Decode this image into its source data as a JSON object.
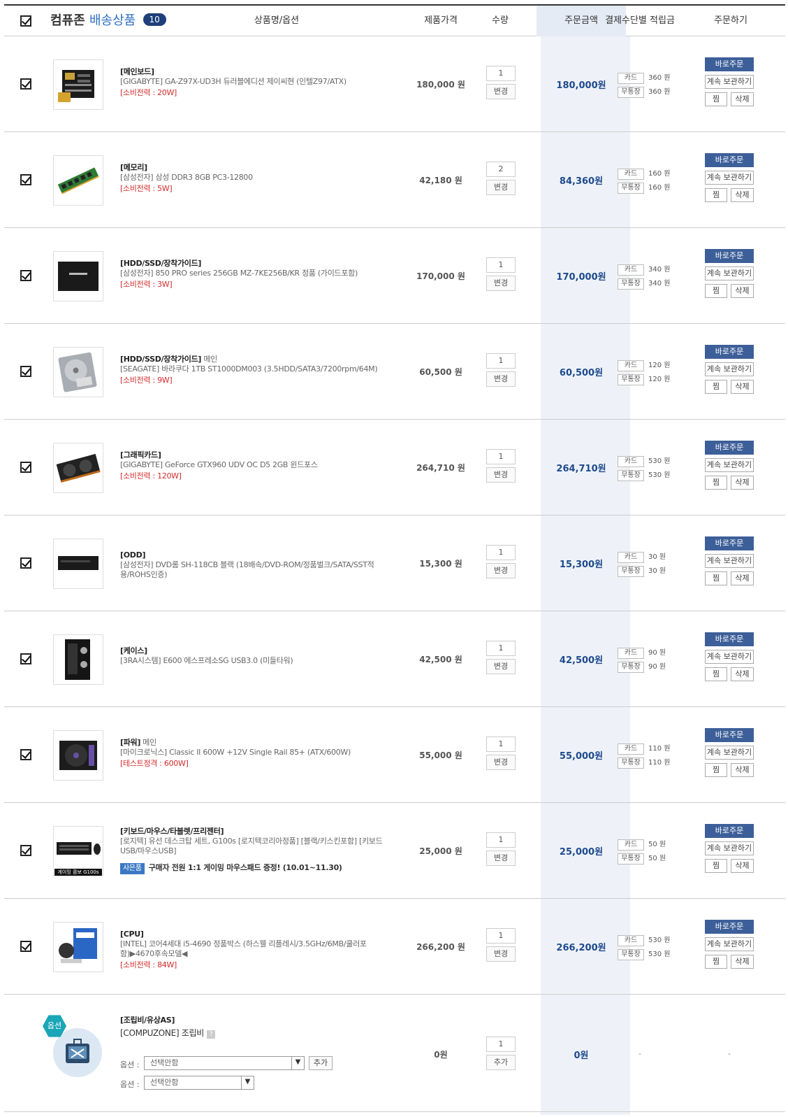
{
  "header": {
    "title_a": "컴퓨존",
    "title_b": "배송상품",
    "count": "10",
    "col_name": "상품명/옵션",
    "col_price": "제품가격",
    "col_qty": "수량",
    "col_amount": "주문금액",
    "col_points": "결제수단별 적립금",
    "col_order": "주문하기"
  },
  "labels": {
    "change": "변경",
    "add": "추가",
    "card": "카드",
    "bankbook": "무통장",
    "buy_now": "바로주문",
    "keep": "계속 보관하기",
    "wish": "찜",
    "delete": "삭제",
    "option": "옵션",
    "option_label": "옵션 :",
    "select_none": "선택안함",
    "gift_tag": "사은품",
    "dash": "-"
  },
  "items": [
    {
      "cat": "[메인보드]",
      "sub": "",
      "name": "[GIGABYTE] GA-Z97X-UD3H 듀러블에디션 제이씨현 (인텔Z97/ATX)",
      "spec": "[소비전력 : 20W]",
      "price": "180,000 원",
      "qty": "1",
      "amount": "180,000원",
      "card_pt": "360 원",
      "bank_pt": "360 원",
      "thumb": "motherboard"
    },
    {
      "cat": "[메모리]",
      "sub": "",
      "name": "[삼성전자] 삼성 DDR3 8GB PC3-12800",
      "spec": "[소비전력 : 5W]",
      "price": "42,180 원",
      "qty": "2",
      "amount": "84,360원",
      "card_pt": "160 원",
      "bank_pt": "160 원",
      "thumb": "memory"
    },
    {
      "cat": "[HDD/SSD/장착가이드]",
      "sub": "",
      "name": "[삼성전자] 850 PRO series 256GB MZ-7KE256B/KR 정품 (가이드포함)",
      "spec": "[소비전력 : 3W]",
      "price": "170,000 원",
      "qty": "1",
      "amount": "170,000원",
      "card_pt": "340 원",
      "bank_pt": "340 원",
      "thumb": "ssd"
    },
    {
      "cat": "[HDD/SSD/장착가이드]",
      "sub": " 메인",
      "name": "[SEAGATE] 바라쿠다 1TB ST1000DM003 (3.5HDD/SATA3/7200rpm/64M)",
      "spec": "[소비전력 : 9W]",
      "price": "60,500 원",
      "qty": "1",
      "amount": "60,500원",
      "card_pt": "120 원",
      "bank_pt": "120 원",
      "thumb": "hdd"
    },
    {
      "cat": "[그래픽카드]",
      "sub": "",
      "name": "[GIGABYTE] GeForce GTX960 UDV OC D5 2GB 윈드포스",
      "spec": "[소비전력 : 120W]",
      "price": "264,710 원",
      "qty": "1",
      "amount": "264,710원",
      "card_pt": "530 원",
      "bank_pt": "530 원",
      "thumb": "gpu"
    },
    {
      "cat": "[ODD]",
      "sub": "",
      "name": "[삼성전자] DVD롬 SH-118CB 블랙 (18배속/DVD-ROM/정품벌크/SATA/SST적용/ROHS인증)",
      "spec": "",
      "price": "15,300 원",
      "qty": "1",
      "amount": "15,300원",
      "card_pt": "30 원",
      "bank_pt": "30 원",
      "thumb": "odd"
    },
    {
      "cat": "[케이스]",
      "sub": "",
      "name": "[3RA시스템] E600 에스프레소SG USB3.0 (미들타워)",
      "spec": "",
      "price": "42,500 원",
      "qty": "1",
      "amount": "42,500원",
      "card_pt": "90 원",
      "bank_pt": "90 원",
      "thumb": "case"
    },
    {
      "cat": "[파워]",
      "sub": " 메인",
      "name": "[마이크로닉스] Classic II 600W +12V Single Rail 85+ (ATX/600W)",
      "spec": "[테스트정격 : 600W]",
      "price": "55,000 원",
      "qty": "1",
      "amount": "55,000원",
      "card_pt": "110 원",
      "bank_pt": "110 원",
      "thumb": "psu"
    },
    {
      "cat": "[키보드/마우스/타블렛/프리젠터]",
      "sub": "",
      "name": "[로지텍] 유선 데스크탑 세트, G100s [로지텍코리아정품] [블랙/키스킨포함] [키보드USB/마우스USB]",
      "spec": "",
      "gift": "구매자 전원 1:1 게이밍 마우스패드 증정! (10.01~11.30)",
      "thumb_caption": "게이밍 콤보 G100s",
      "price": "25,000 원",
      "qty": "1",
      "amount": "25,000원",
      "card_pt": "50 원",
      "bank_pt": "50 원",
      "thumb": "keyboard"
    },
    {
      "cat": "[CPU]",
      "sub": "",
      "name": "[INTEL] 코어4세대 i5-4690 정품박스 (하스웰 리플레시/3.5GHz/6MB/쿨러포함)▶4670후속모델◀",
      "spec": "[소비전력 : 84W]",
      "price": "266,200 원",
      "qty": "1",
      "amount": "266,200원",
      "card_pt": "530 원",
      "bank_pt": "530 원",
      "thumb": "cpu"
    }
  ],
  "assembly": {
    "cat": "[조립비/유상AS]",
    "name": "[COMPUZONE] 조립비",
    "help": "?",
    "price": "0원",
    "qty": "1",
    "amount": "0원"
  },
  "colors": {
    "accent": "#3d5f99",
    "amount": "#1e4a8c",
    "spec": "#d42b2b",
    "badge": "#1e3f7a"
  }
}
